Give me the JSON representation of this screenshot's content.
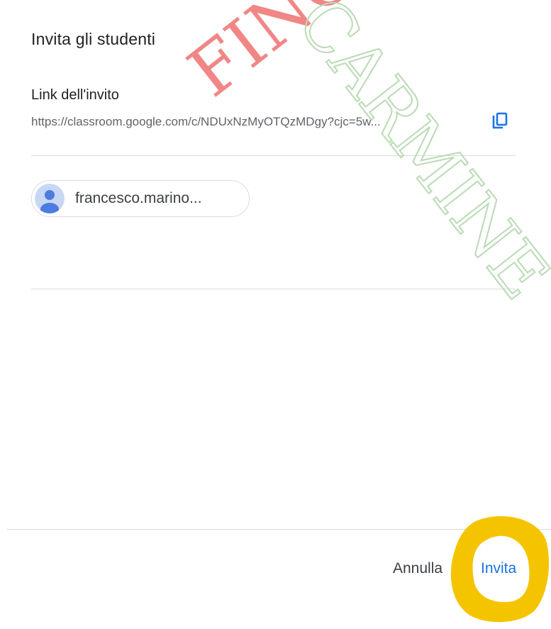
{
  "dialog": {
    "title": "Invita gli studenti",
    "link_label": "Link dell'invito",
    "link_url": "https://classroom.google.com/c/NDUxNzMyOTQzMDgy?cjc=5w...",
    "invitee_chip": {
      "label": "francesco.marino..."
    },
    "cancel_label": "Annulla",
    "invite_label": "Invita"
  },
  "watermarks": [
    {
      "text": "FINC",
      "color": "#f08080"
    },
    {
      "text": "CARMINE",
      "color": "#c7e2c3"
    }
  ],
  "highlight": {
    "color": "#f5c400",
    "target": "invite-button"
  },
  "colors": {
    "accent": "#1a73e8",
    "text_primary": "#202124",
    "text_secondary": "#5f6368",
    "divider": "#dadce0",
    "avatar_bg": "#c8d7f4",
    "avatar_fg": "#4d7ce0"
  },
  "icons": {
    "copy": "copy-icon",
    "avatar": "person-avatar-icon"
  }
}
